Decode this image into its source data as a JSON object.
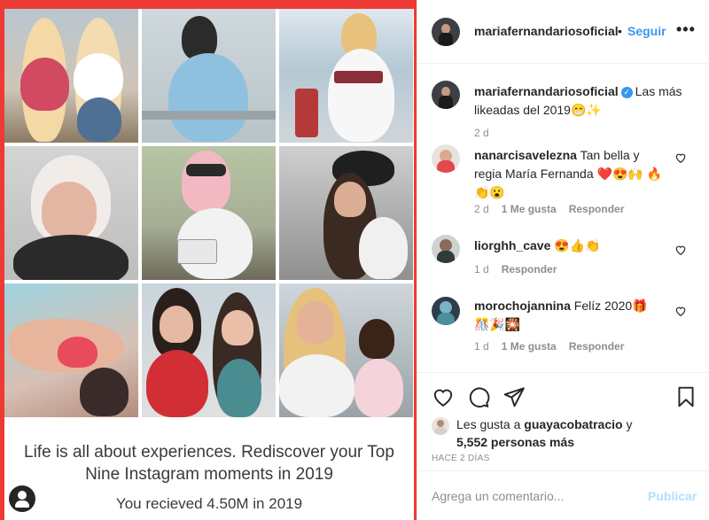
{
  "post": {
    "username": "mariafernandariosoficial",
    "follow_label": "Seguir",
    "separator": "•",
    "more_label": "•••",
    "caption_text": "Las más likeadas del 2019😁✨",
    "caption_time": "2 d"
  },
  "media": {
    "headline": "Life is all about experiences. Rediscover your Top Nine Instagram moments in 2019",
    "received": "You recieved 4.50M in 2019"
  },
  "comments": [
    {
      "username": "nanarcisavelezna",
      "text": "Tan bella y regia María Fernanda ❤️😍🙌 🔥👏😮",
      "time": "2 d",
      "likes": "1 Me gusta",
      "reply": "Responder"
    },
    {
      "username": "liorghh_cave",
      "text": "😍👍👏",
      "time": "1 d",
      "likes": "",
      "reply": "Responder"
    },
    {
      "username": "morochojannina",
      "text": "Felíz 2020🎁 🎊🎉🎇",
      "time": "1 d",
      "likes": "1 Me gusta",
      "reply": "Responder"
    }
  ],
  "engagement": {
    "likes_prefix": "Les gusta a",
    "likes_user": "guayacobatracio",
    "likes_and": "y",
    "likes_others": "5,552 personas más",
    "time_ago": "HACE 2 DÍAS"
  },
  "composer": {
    "placeholder": "Agrega un comentario...",
    "publish_label": "Publicar"
  },
  "colors": {
    "accent": "#3897f0",
    "frame": "#ee3a34",
    "publish_disabled": "#b2dffc",
    "muted": "#8e8e8e"
  }
}
